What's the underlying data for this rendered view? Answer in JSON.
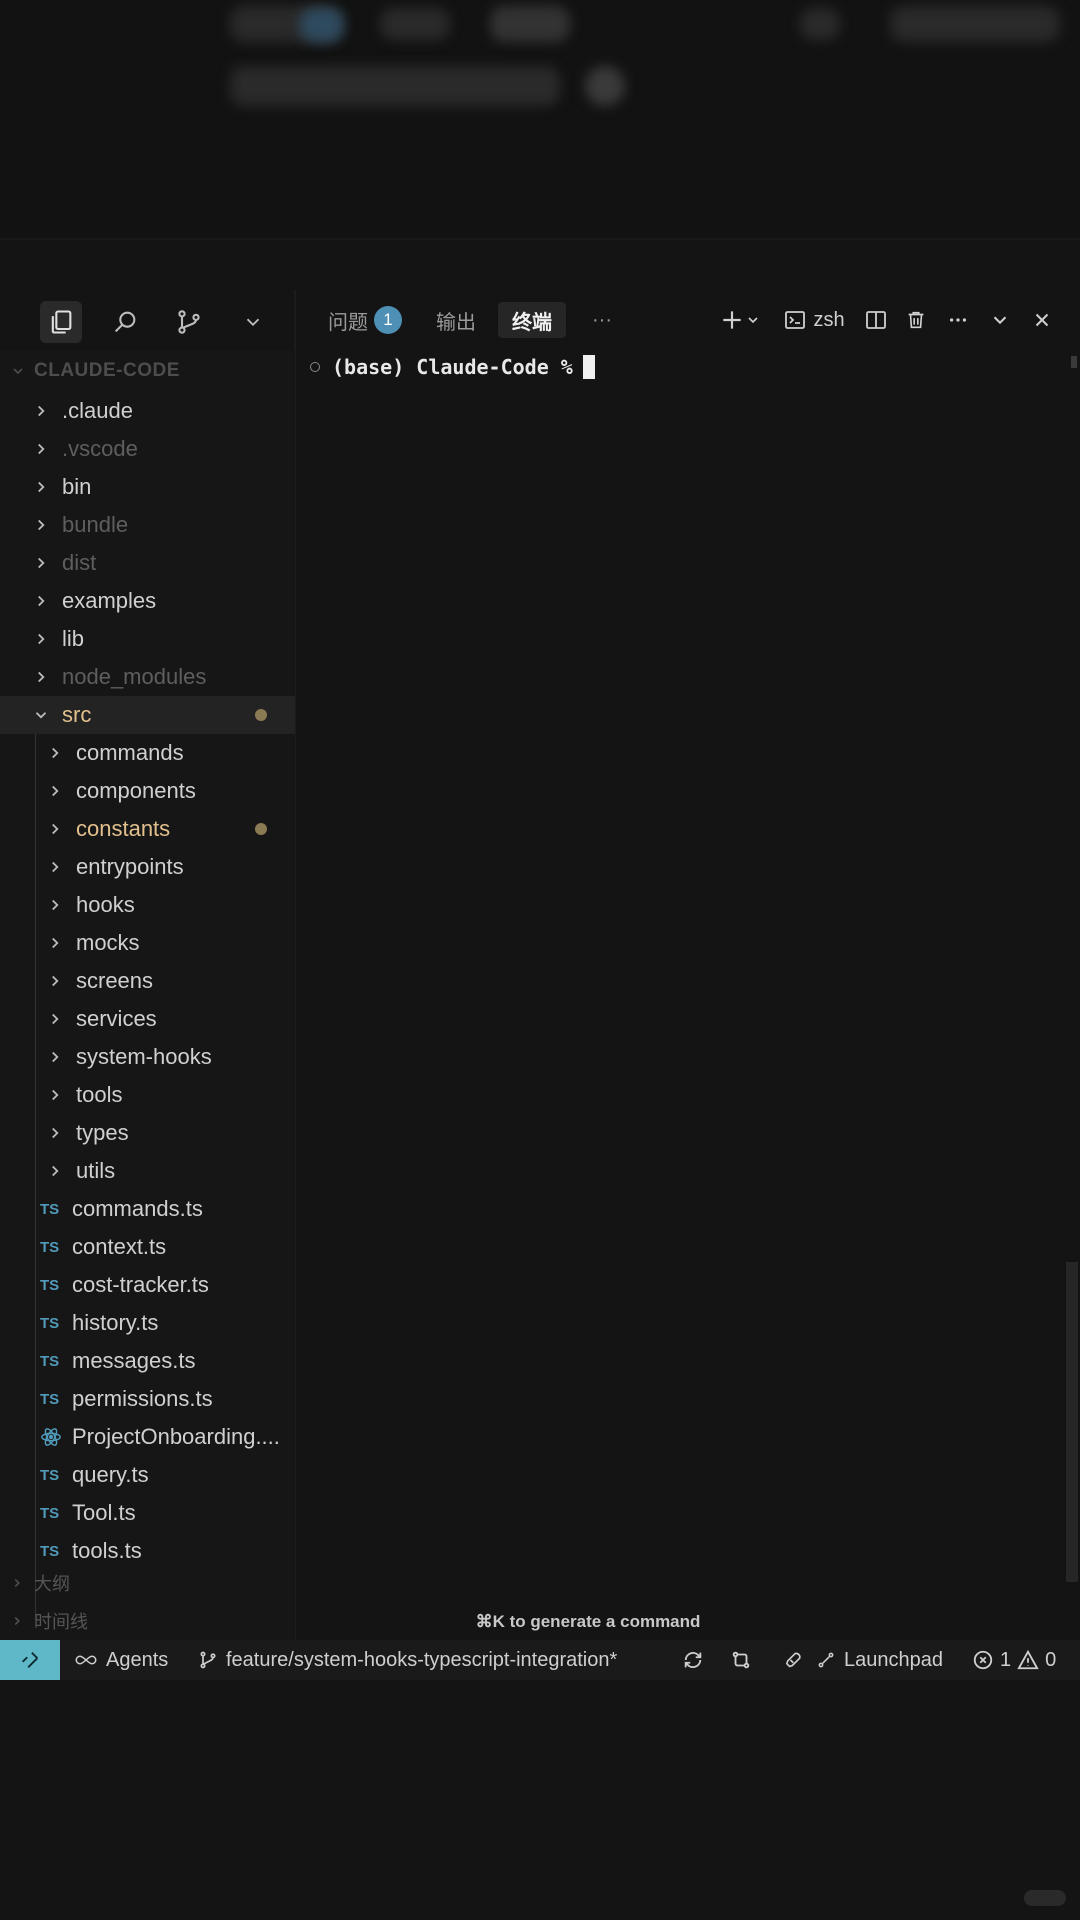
{
  "explorer": {
    "root_label": "CLAUDE-CODE",
    "items": [
      {
        "label": ".claude",
        "kind": "folder",
        "state": "normal"
      },
      {
        "label": ".vscode",
        "kind": "folder",
        "state": "dim"
      },
      {
        "label": "bin",
        "kind": "folder",
        "state": "normal"
      },
      {
        "label": "bundle",
        "kind": "folder",
        "state": "dim"
      },
      {
        "label": "dist",
        "kind": "folder",
        "state": "dim"
      },
      {
        "label": "examples",
        "kind": "folder",
        "state": "normal"
      },
      {
        "label": "lib",
        "kind": "folder",
        "state": "normal"
      },
      {
        "label": "node_modules",
        "kind": "folder",
        "state": "dim"
      },
      {
        "label": "src",
        "kind": "folder-open",
        "state": "modified"
      },
      {
        "label": "commands",
        "kind": "folder",
        "state": "normal"
      },
      {
        "label": "components",
        "kind": "folder",
        "state": "normal"
      },
      {
        "label": "constants",
        "kind": "folder",
        "state": "modified"
      },
      {
        "label": "entrypoints",
        "kind": "folder",
        "state": "normal"
      },
      {
        "label": "hooks",
        "kind": "folder",
        "state": "normal"
      },
      {
        "label": "mocks",
        "kind": "folder",
        "state": "normal"
      },
      {
        "label": "screens",
        "kind": "folder",
        "state": "normal"
      },
      {
        "label": "services",
        "kind": "folder",
        "state": "normal"
      },
      {
        "label": "system-hooks",
        "kind": "folder",
        "state": "normal"
      },
      {
        "label": "tools",
        "kind": "folder",
        "state": "normal"
      },
      {
        "label": "types",
        "kind": "folder",
        "state": "normal"
      },
      {
        "label": "utils",
        "kind": "folder",
        "state": "normal"
      },
      {
        "label": "commands.ts",
        "kind": "ts",
        "state": "normal"
      },
      {
        "label": "context.ts",
        "kind": "ts",
        "state": "normal"
      },
      {
        "label": "cost-tracker.ts",
        "kind": "ts",
        "state": "normal"
      },
      {
        "label": "history.ts",
        "kind": "ts",
        "state": "normal"
      },
      {
        "label": "messages.ts",
        "kind": "ts",
        "state": "normal"
      },
      {
        "label": "permissions.ts",
        "kind": "ts",
        "state": "normal"
      },
      {
        "label": "ProjectOnboarding....",
        "kind": "react",
        "state": "normal"
      },
      {
        "label": "query.ts",
        "kind": "ts",
        "state": "normal"
      },
      {
        "label": "Tool.ts",
        "kind": "ts",
        "state": "normal"
      },
      {
        "label": "tools.ts",
        "kind": "ts",
        "state": "normal"
      }
    ],
    "ts_badge": "TS",
    "sections": [
      "大纲",
      "时间线"
    ]
  },
  "panel": {
    "tabs": {
      "problems": "问题",
      "problems_count": "1",
      "output": "输出",
      "terminal": "终端",
      "more": "···"
    },
    "shell_name": "zsh",
    "prompt": "(base) Claude-Code %",
    "generate_hint": "⌘K to generate a command"
  },
  "status_bar": {
    "agents": "Agents",
    "branch": "feature/system-hooks-typescript-integration*",
    "launchpad": "Launchpad",
    "errors": "1",
    "warnings": "0"
  },
  "colors": {
    "accent": "#5fb8c8",
    "modified": "#e2c08d",
    "ts_icon": "#519aba",
    "badge": "#4d8fb5"
  }
}
